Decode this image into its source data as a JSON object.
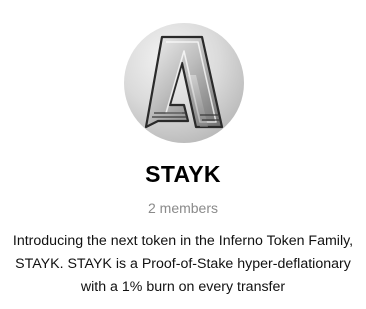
{
  "channel": {
    "name": "STAYK",
    "members_label": "2 members",
    "description": "Introducing the next token in the Inferno Token Family, STAYK. STAYK is a Proof-of-Stake hyper-deflationary with a 1% burn on every transfer",
    "avatar_icon": "stayk-logo-icon"
  }
}
